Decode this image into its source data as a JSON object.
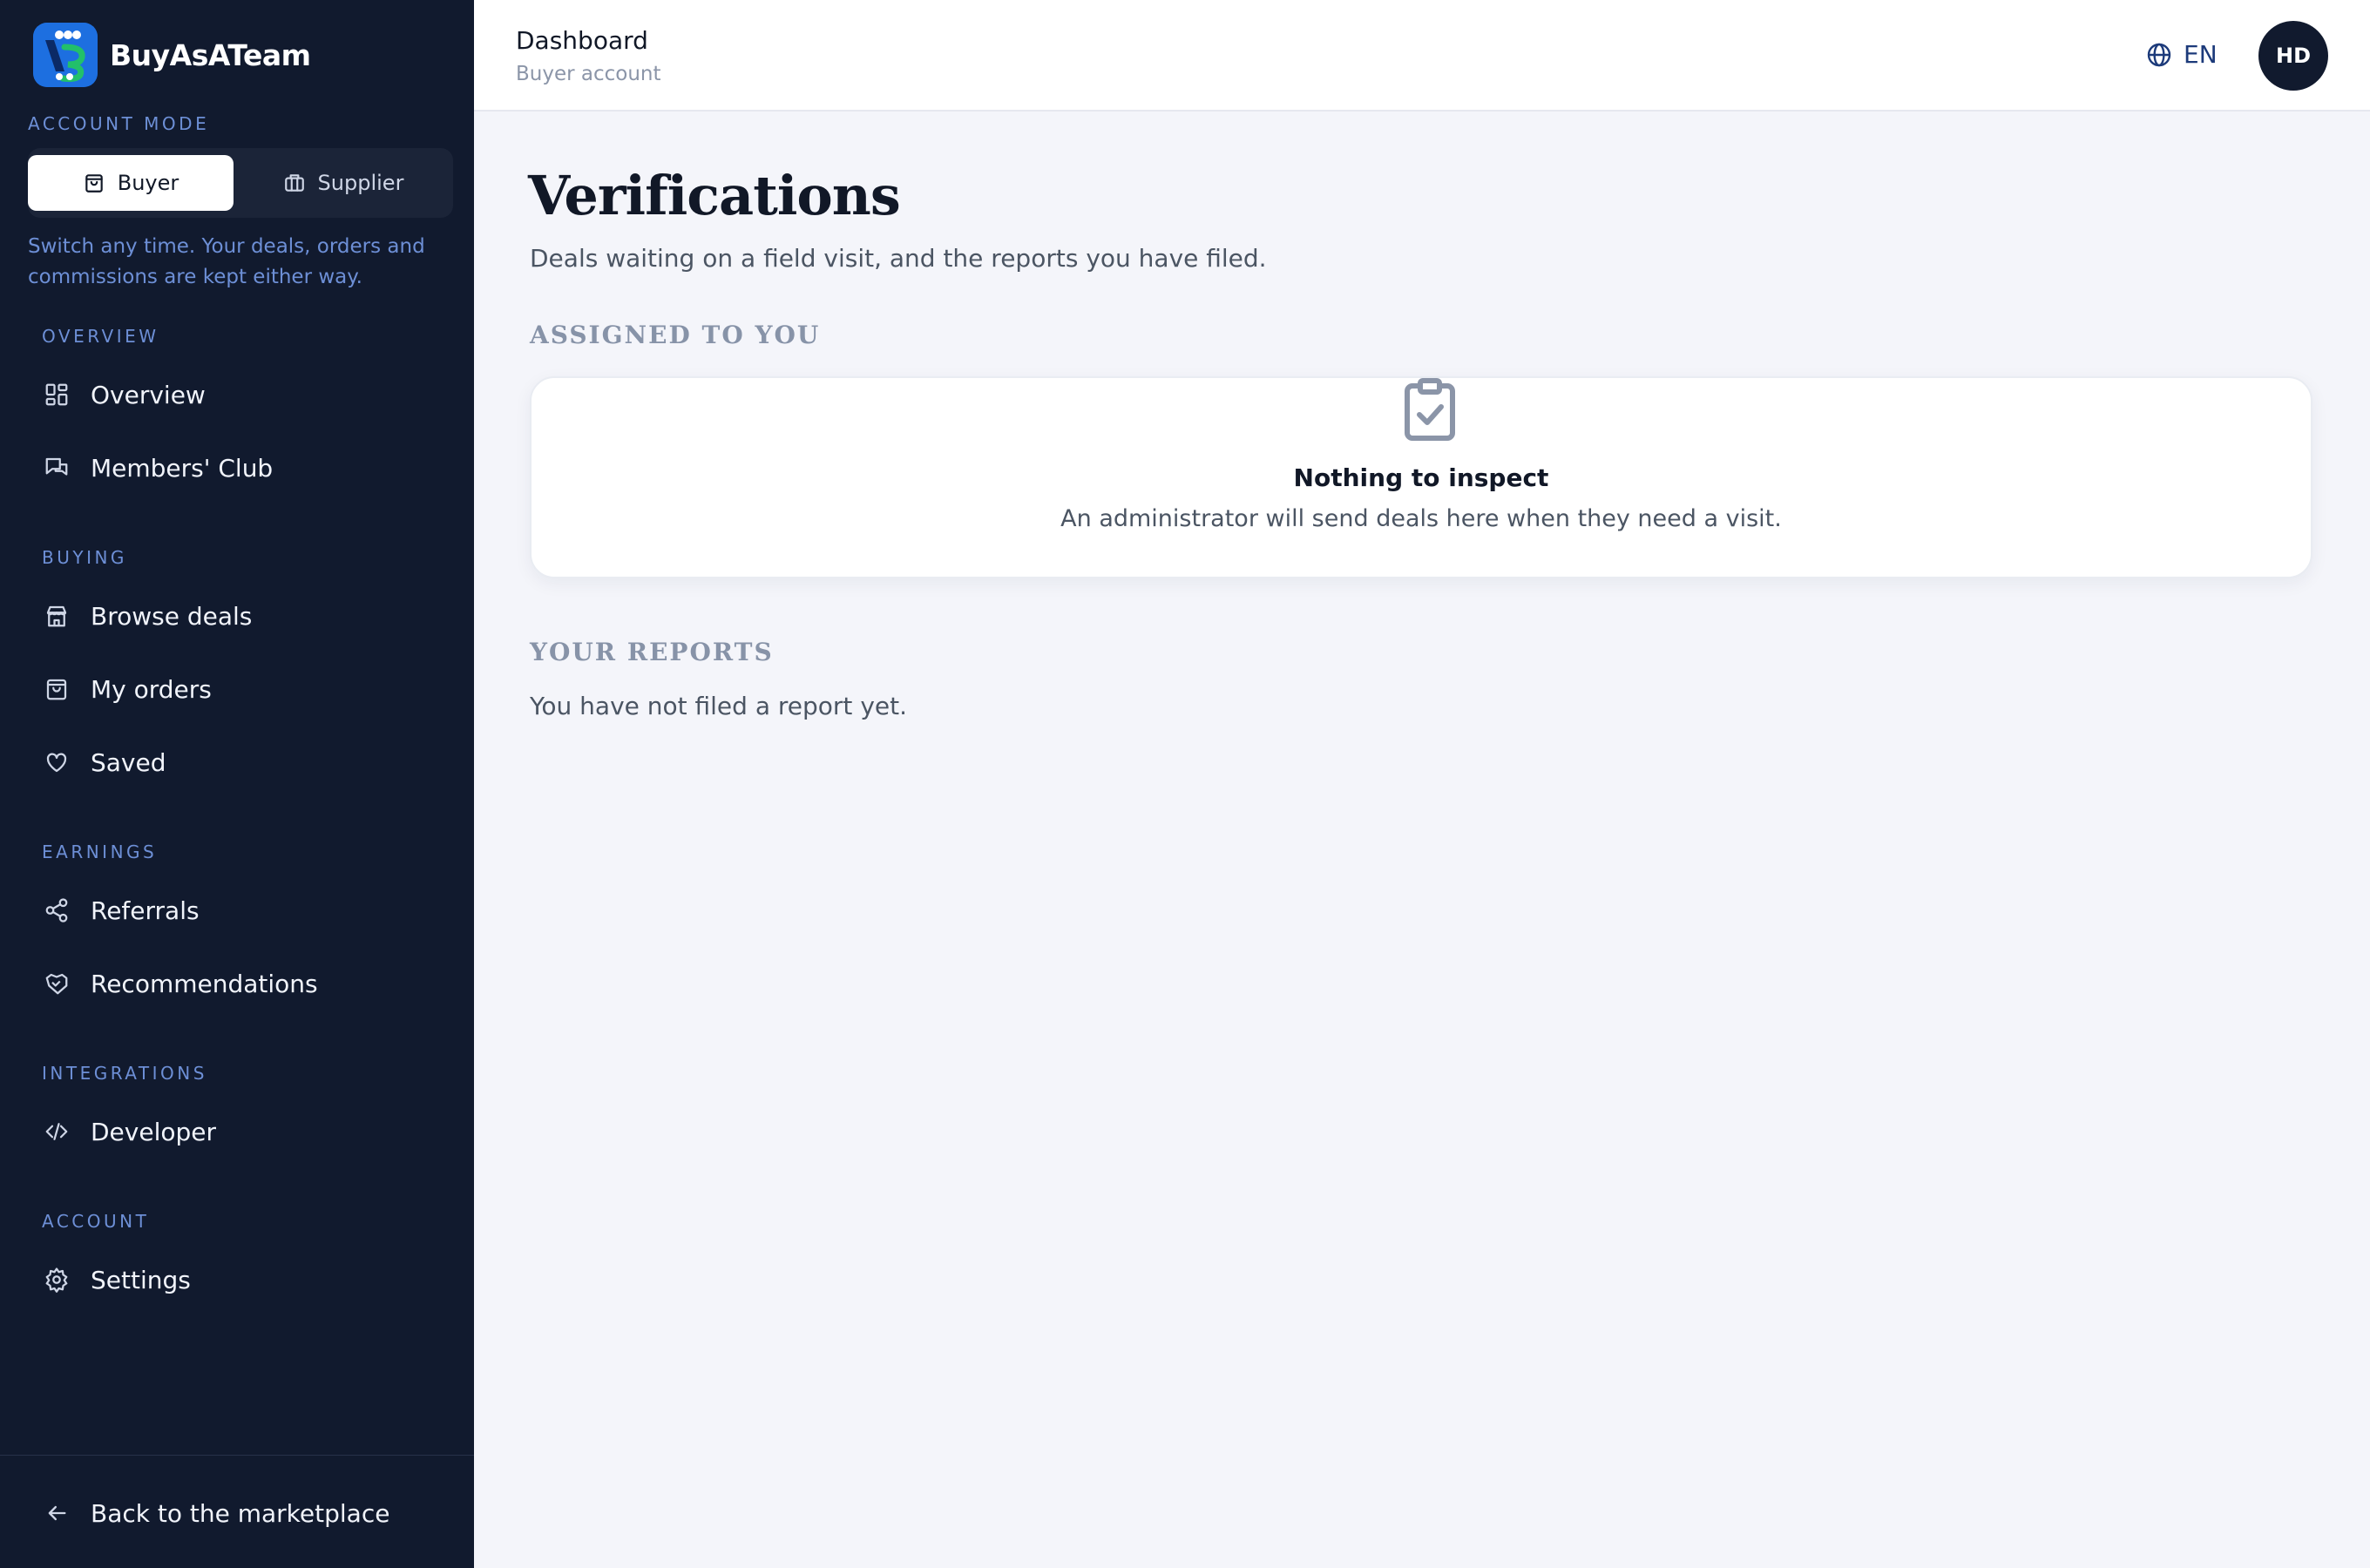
{
  "brand": {
    "name": "BuyAsATeam"
  },
  "account_mode": {
    "label": "ACCOUNT MODE",
    "buyer": "Buyer",
    "supplier": "Supplier",
    "active": "Buyer",
    "hint": "Switch any time. Your deals, orders and commissions are kept either way."
  },
  "nav": {
    "overview": {
      "section": "OVERVIEW",
      "items": [
        {
          "label": "Overview"
        },
        {
          "label": "Members' Club"
        }
      ]
    },
    "buying": {
      "section": "BUYING",
      "items": [
        {
          "label": "Browse deals"
        },
        {
          "label": "My orders"
        },
        {
          "label": "Saved"
        }
      ]
    },
    "earnings": {
      "section": "EARNINGS",
      "items": [
        {
          "label": "Referrals"
        },
        {
          "label": "Recommendations"
        }
      ]
    },
    "integrations": {
      "section": "INTEGRATIONS",
      "items": [
        {
          "label": "Developer"
        }
      ]
    },
    "account": {
      "section": "ACCOUNT",
      "items": [
        {
          "label": "Settings"
        }
      ]
    }
  },
  "back_link": "Back to the marketplace",
  "topbar": {
    "title": "Dashboard",
    "subtitle": "Buyer account",
    "language": "EN",
    "avatar_initials": "HD"
  },
  "page": {
    "title": "Verifications",
    "subtitle": "Deals waiting on a field visit, and the reports you have filed.",
    "assigned": {
      "heading": "ASSIGNED TO YOU",
      "empty_title": "Nothing to inspect",
      "empty_desc": "An administrator will send deals here when they need a visit."
    },
    "reports": {
      "heading": "YOUR REPORTS",
      "empty": "You have not filed a report yet."
    }
  },
  "colors": {
    "sidebar_bg": "#111a2e",
    "accent": "#6d8fd6",
    "page_bg": "#f4f5fa",
    "logo_blue": "#1d6fe0"
  },
  "icons": {
    "overview": "grid-icon",
    "members_club": "chat-icon",
    "browse_deals": "store-icon",
    "my_orders": "bag-icon",
    "saved": "heart-icon",
    "referrals": "share-icon",
    "recommendations": "handshake-icon",
    "developer": "code-icon",
    "settings": "gear-icon",
    "back": "arrow-left-icon",
    "language": "globe-icon",
    "empty": "clipboard-check-icon"
  }
}
